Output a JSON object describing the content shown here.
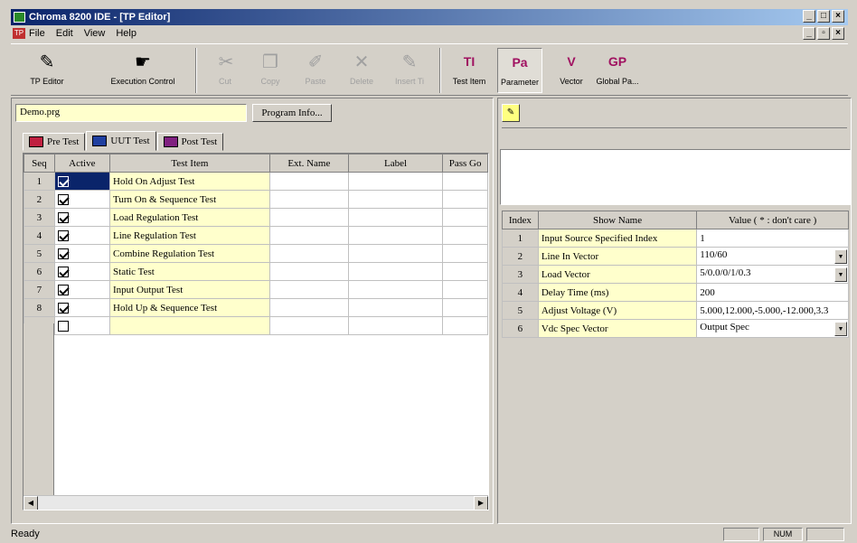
{
  "window": {
    "title": "Chroma 8200 IDE - [TP Editor]"
  },
  "menu": {
    "items": [
      "File",
      "Edit",
      "View",
      "Help"
    ]
  },
  "toolbar": {
    "tp_editor": "TP Editor",
    "execution_control": "Execution Control",
    "cut": "Cut",
    "copy": "Copy",
    "paste": "Paste",
    "delete": "Delete",
    "insert": "Insert Ti",
    "test_item": "Test Item",
    "parameter": "Parameter",
    "vector": "Vector",
    "global": "Global Pa..."
  },
  "left": {
    "filename": "Demo.prg",
    "program_info_button": "Program Info...",
    "tabs": [
      "Pre Test",
      "UUT Test",
      "Post Test"
    ],
    "columns": [
      "Seq",
      "Active",
      "Test Item",
      "Ext. Name",
      "Label",
      "Pass Go"
    ],
    "rows": [
      {
        "seq": "1",
        "active": true,
        "item": "Hold On Adjust Test"
      },
      {
        "seq": "2",
        "active": true,
        "item": "Turn On & Sequence Test"
      },
      {
        "seq": "3",
        "active": true,
        "item": "Load Regulation Test"
      },
      {
        "seq": "4",
        "active": true,
        "item": "Line Regulation Test"
      },
      {
        "seq": "5",
        "active": true,
        "item": "Combine Regulation Test"
      },
      {
        "seq": "6",
        "active": true,
        "item": "Static Test"
      },
      {
        "seq": "7",
        "active": true,
        "item": "Input Output Test"
      },
      {
        "seq": "8",
        "active": true,
        "item": "Hold Up & Sequence Test"
      },
      {
        "seq": "",
        "active": false,
        "item": ""
      }
    ]
  },
  "right": {
    "columns": [
      "Index",
      "Show Name",
      "Value ( * : don't care )"
    ],
    "rows": [
      {
        "index": "1",
        "name": "Input Source Specified Index",
        "value": "1",
        "dropdown": false
      },
      {
        "index": "2",
        "name": "Line In Vector",
        "value": "110/60",
        "dropdown": true
      },
      {
        "index": "3",
        "name": "Load Vector",
        "value": "5/0.0/0/1/0.3",
        "dropdown": true
      },
      {
        "index": "4",
        "name": "Delay Time (ms)",
        "value": "200",
        "dropdown": false
      },
      {
        "index": "5",
        "name": "Adjust Voltage (V)",
        "value": "5.000,12.000,-5.000,-12.000,3.3",
        "dropdown": false
      },
      {
        "index": "6",
        "name": "Vdc Spec Vector",
        "value": "Output Spec",
        "dropdown": true
      }
    ]
  },
  "status": {
    "text": "Ready",
    "num": "NUM"
  }
}
